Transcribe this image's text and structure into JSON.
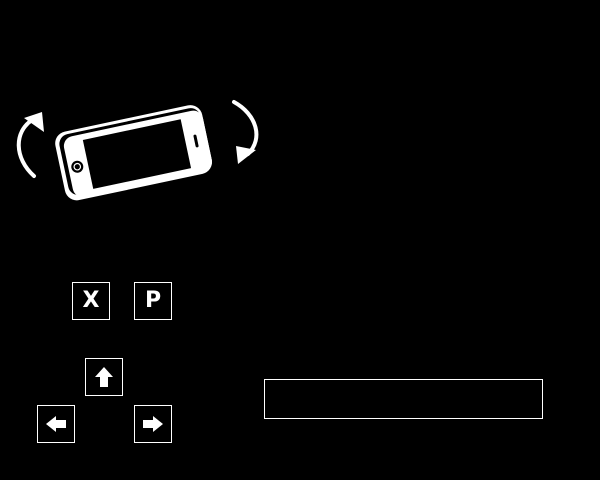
{
  "rotate_hint": {
    "icons": [
      "rotate-counterclockwise-arrow",
      "phone-landscape",
      "rotate-clockwise-arrow"
    ]
  },
  "controls": {
    "keys": [
      {
        "label": "X",
        "icon": null
      },
      {
        "label": "P",
        "icon": null
      },
      {
        "label": "",
        "icon": "arrow-up-icon"
      },
      {
        "label": "",
        "icon": "arrow-left-icon"
      },
      {
        "label": "",
        "icon": "arrow-right-icon"
      }
    ]
  },
  "message_box": {
    "text": ""
  },
  "colors": {
    "background": "#000000",
    "foreground": "#ffffff"
  }
}
